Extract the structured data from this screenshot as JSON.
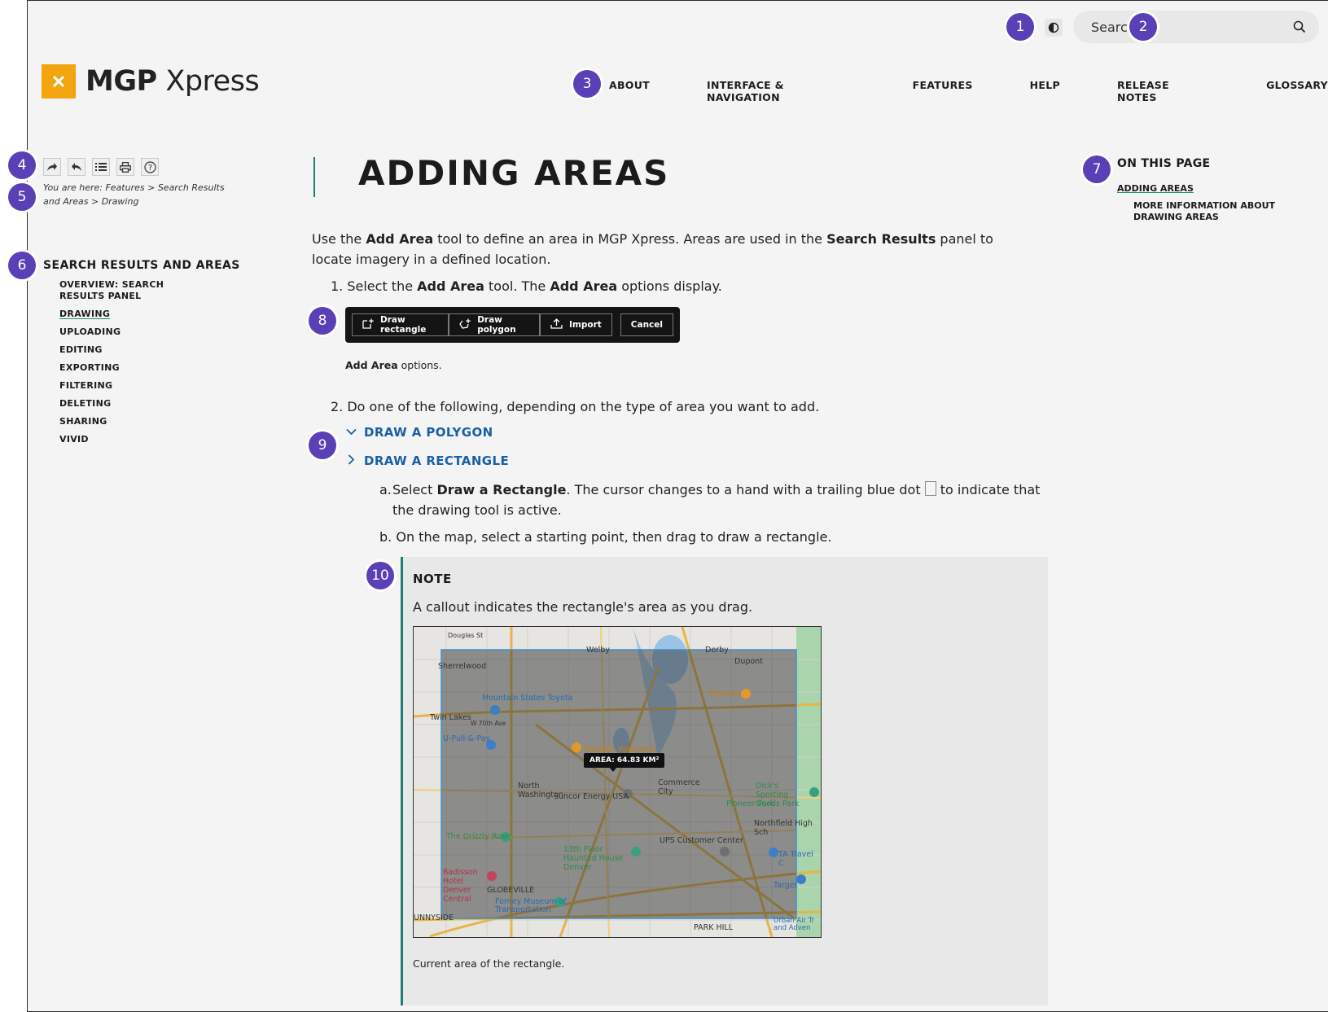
{
  "markers": [
    "1",
    "2",
    "3",
    "4",
    "5",
    "6",
    "7",
    "8",
    "9",
    "10"
  ],
  "header": {
    "contrast_icon": "contrast-icon",
    "search_placeholder": "Search",
    "search_icon": "search-icon"
  },
  "logo": {
    "brand_bold": "MGP",
    "brand_light": "Xpress",
    "mark_icon": "logo-x-icon",
    "color": "#f3a50f"
  },
  "topnav": [
    "ABOUT",
    "INTERFACE & NAVIGATION",
    "FEATURES",
    "HELP",
    "RELEASE NOTES",
    "GLOSSARY"
  ],
  "toolbar": {
    "icons": [
      "forward-icon",
      "back-icon",
      "list-icon",
      "print-icon",
      "help-icon"
    ]
  },
  "breadcrumb": "You are here: Features > Search Results and Areas > Drawing",
  "sidenav": {
    "title": "SEARCH RESULTS AND AREAS",
    "items": [
      "OVERVIEW: SEARCH RESULTS PANEL",
      "DRAWING",
      "UPLOADING",
      "EDITING",
      "EXPORTING",
      "FILTERING",
      "DELETING",
      "SHARING",
      "VIVID"
    ],
    "active": "DRAWING"
  },
  "toc": {
    "title": "ON THIS PAGE",
    "items": [
      "ADDING AREAS",
      "MORE INFORMATION ABOUT DRAWING AREAS"
    ]
  },
  "content": {
    "title": "ADDING AREAS",
    "intro": {
      "p1": "Use the ",
      "b1": "Add Area",
      "p2": " tool to define an area in MGP Xpress. Areas are used in the ",
      "b2": "Search Results",
      "p3": " panel to locate imagery in a defined location."
    },
    "step1": {
      "num": "1.",
      "p1": "Select the ",
      "b1": "Add Area",
      "p2": " tool. The ",
      "b2": "Add Area",
      "p3": " options display."
    },
    "options": [
      "Draw rectangle",
      "Draw polygon",
      "Import",
      "Cancel"
    ],
    "options_caption_bold": "Add Area",
    "options_caption_rest": " options.",
    "step2": {
      "num": "2.",
      "text": "Do one of the following, depending on the type of area you want to add."
    },
    "expanders": [
      "DRAW A POLYGON",
      "DRAW A RECTANGLE"
    ],
    "substep_a": {
      "num": "a.",
      "p1": "Select ",
      "b1": "Draw a Rectangle",
      "p2": ". The cursor changes to a hand with a trailing blue dot ",
      "p3": " to indicate that the drawing tool is active."
    },
    "substep_b": {
      "num": "b.",
      "text": "On the map, select a starting point, then drag to draw a rectangle."
    },
    "note": {
      "title": "NOTE",
      "text": "A callout indicates the rectangle's area as you drag.",
      "map_callout": "AREA: 64.83 KM²",
      "map_places": [
        "Douglas St",
        "Welby",
        "Derby",
        "Dupont",
        "Sherrelwood",
        "Mountain States Toyota",
        "El Jardin",
        "Twin Lakes",
        "W 70th Ave",
        "U-Pull-&-Pay",
        "Baldwin Vineyards",
        "North Washington",
        "Suncor Energy USA",
        "Commerce City",
        "Dick's Sporting Goods Park",
        "Pioneer Park",
        "Northfield High Sch",
        "The Grizzly Rose",
        "UPS Customer Center",
        "TA Travel C",
        "13th Floor Haunted House Denver",
        "Radisson Hotel Denver Central",
        "GLOBEVILLE",
        "Target",
        "Forney Museum of Transportation",
        "UNNYSIDE",
        "PARK HILL",
        "Urban Air Tr and Adven"
      ],
      "caption": "Current area of the rectangle."
    }
  }
}
